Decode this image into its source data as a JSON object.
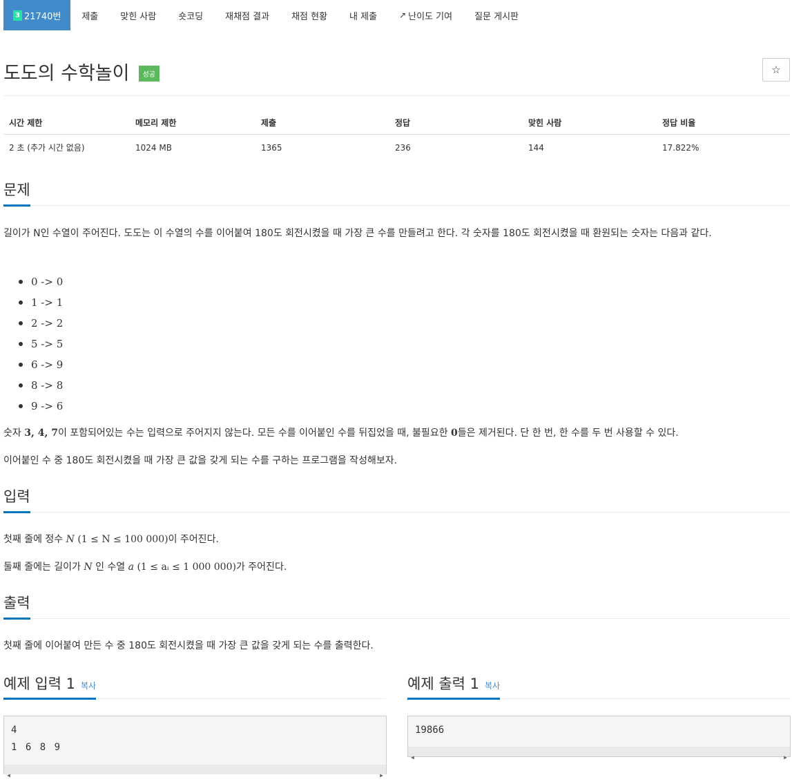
{
  "nav": {
    "tier_label": "3",
    "problem_number": "21740번",
    "items": [
      "제출",
      "맞힌 사람",
      "숏코딩",
      "재채점 결과",
      "채점 현황",
      "내 제출",
      "난이도 기여",
      "질문 게시판"
    ]
  },
  "problem": {
    "title": "도도의 수학놀이",
    "status_badge": "성공",
    "star": "☆"
  },
  "info_table": {
    "headers": [
      "시간 제한",
      "메모리 제한",
      "제출",
      "정답",
      "맞힌 사람",
      "정답 비율"
    ],
    "values": [
      "2 초 (추가 시간 없음)",
      "1024 MB",
      "1365",
      "236",
      "144",
      "17.822%"
    ]
  },
  "sections": {
    "problem_heading": "문제",
    "problem_p1": "길이가 N인 수열이 주어진다. 도도는 이 수열의 수를 이어붙여 180도 회전시켰을 때 가장 큰 수를 만들려고 한다. 각 숫자를 180도 회전시켰을 때 환원되는 숫자는 다음과 같다.",
    "rotations": [
      "0 -> 0",
      "1 -> 1",
      "2 -> 2",
      "5 -> 5",
      "6 -> 9",
      "8 -> 8",
      "9 -> 6"
    ],
    "problem_p2_pre": "숫자 ",
    "problem_p2_digits": "3, 4, 7",
    "problem_p2_mid": "이 포함되어있는 수는 입력으로 주어지지 않는다. 모든 수를 이어붙인 수를 뒤집었을 때, 불필요한 ",
    "problem_p2_zero": "0",
    "problem_p2_post": "들은 제거된다. 단 한 번, 한 수를 두 번 사용할 수 있다.",
    "problem_p3": "이어붙인 수 중 180도 회전시켰을 때 가장 큰 값을 갖게 되는 수를 구하는 프로그램을 작성해보자.",
    "input_heading": "입력",
    "input_p1_pre": "첫째 줄에 정수 ",
    "input_p1_math": "(1 ≤ N ≤ 100 000)",
    "input_p1_post": "이 주어진다.",
    "input_p2_pre": "둘째 줄에는 길이가 ",
    "input_p2_mid": " 인 수열 ",
    "input_p2_math": "(1 ≤ aᵢ ≤ 1 000 000)",
    "input_p2_post": "가 주어진다.",
    "var_N": "N",
    "var_a": "a",
    "output_heading": "출력",
    "output_p1": "첫째 줄에 이어붙여 만든 수 중 180도 회전시켰을 때 가장 큰 값을 갖게 되는 수를 출력한다."
  },
  "samples": {
    "input_heading": "예제 입력 1",
    "output_heading": "예제 출력 1",
    "copy_label": "복사",
    "input_line1": "4",
    "input_line2": "1 6 8 9",
    "output_line1": "19866"
  },
  "colors": {
    "accent": "#428bca",
    "success": "#5cb85c",
    "underline": "#0076c0"
  }
}
